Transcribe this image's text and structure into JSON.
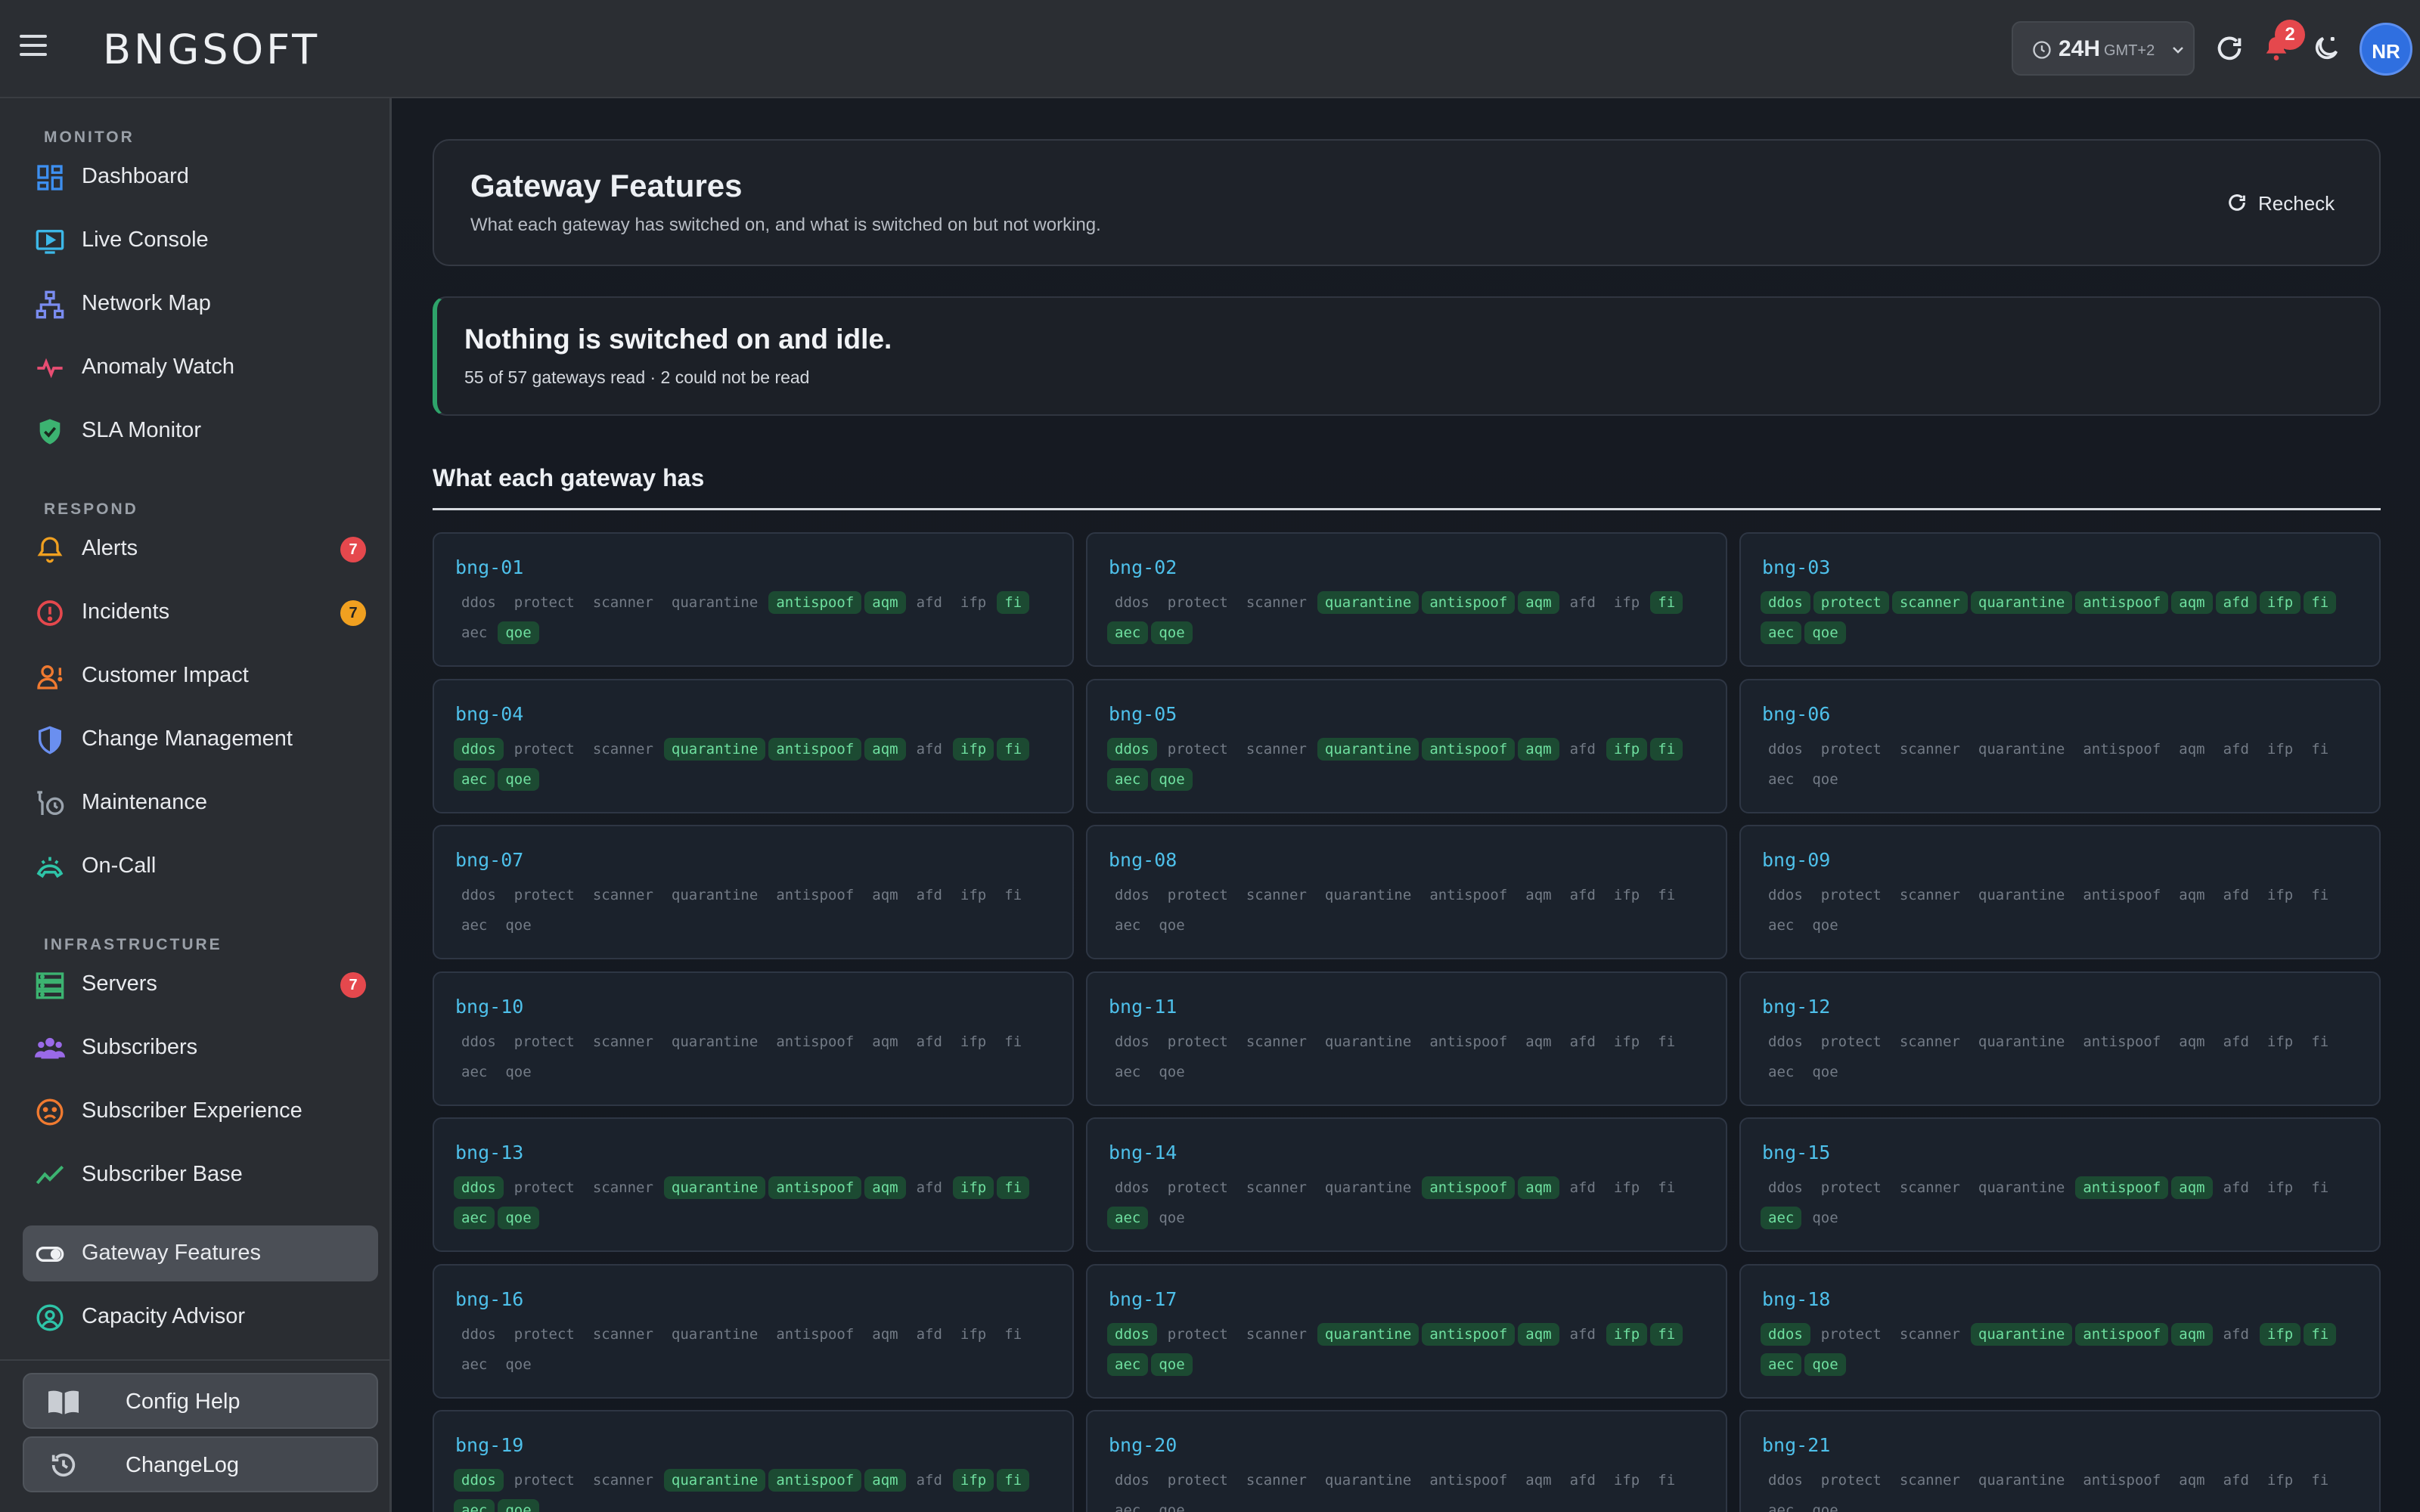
{
  "app": {
    "logo": "BNGSOFT",
    "time_range": "24H",
    "timezone": "GMT+2",
    "notification_count": "2",
    "user_initials": "NR"
  },
  "sidebar": {
    "sections": [
      {
        "label": "MONITOR"
      },
      {
        "label": "RESPOND"
      },
      {
        "label": "INFRASTRUCTURE"
      }
    ],
    "items": [
      {
        "label": "Dashboard",
        "icon": "dashboard-icon"
      },
      {
        "label": "Live Console",
        "icon": "monitor-play-icon"
      },
      {
        "label": "Network Map",
        "icon": "network-icon"
      },
      {
        "label": "Anomaly Watch",
        "icon": "pulse-icon"
      },
      {
        "label": "SLA Monitor",
        "icon": "shield-check-icon"
      },
      {
        "label": "Alerts",
        "icon": "bell-icon",
        "count": "7"
      },
      {
        "label": "Incidents",
        "icon": "alert-circle-icon",
        "count": "7"
      },
      {
        "label": "Customer Impact",
        "icon": "user-alert-icon"
      },
      {
        "label": "Change Management",
        "icon": "shield-half-icon"
      },
      {
        "label": "Maintenance",
        "icon": "wrench-clock-icon"
      },
      {
        "label": "On-Call",
        "icon": "headset-icon"
      },
      {
        "label": "Servers",
        "icon": "server-icon",
        "count": "7"
      },
      {
        "label": "Subscribers",
        "icon": "users-icon"
      },
      {
        "label": "Subscriber Experience",
        "icon": "sad-face-icon"
      },
      {
        "label": "Subscriber Base",
        "icon": "trend-line-icon"
      },
      {
        "label": "Gateway Features",
        "icon": "toggle-icon"
      },
      {
        "label": "Capacity Advisor",
        "icon": "gauge-icon"
      }
    ],
    "footer": {
      "config_help": "Config Help",
      "changelog": "ChangeLog"
    }
  },
  "header": {
    "title": "Gateway Features",
    "subtitle": "What each gateway has switched on, and what is switched on but not working.",
    "recheck_label": "Recheck"
  },
  "status": {
    "title": "Nothing is switched on and idle.",
    "detail": "55 of 57 gateways read · 2 could not be read"
  },
  "section_title": "What each gateway has",
  "features": [
    "ddos",
    "protect",
    "scanner",
    "quarantine",
    "antispoof",
    "aqm",
    "afd",
    "ifp",
    "fi",
    "aec",
    "qoe"
  ],
  "gateways": [
    {
      "name": "bng-01",
      "on": [
        "antispoof",
        "aqm",
        "fi",
        "qoe"
      ]
    },
    {
      "name": "bng-02",
      "on": [
        "quarantine",
        "antispoof",
        "aqm",
        "fi",
        "aec",
        "qoe"
      ]
    },
    {
      "name": "bng-03",
      "on": [
        "ddos",
        "protect",
        "scanner",
        "quarantine",
        "antispoof",
        "aqm",
        "afd",
        "ifp",
        "fi",
        "aec",
        "qoe"
      ]
    },
    {
      "name": "bng-04",
      "on": [
        "ddos",
        "quarantine",
        "antispoof",
        "aqm",
        "ifp",
        "fi",
        "aec",
        "qoe"
      ]
    },
    {
      "name": "bng-05",
      "on": [
        "ddos",
        "quarantine",
        "antispoof",
        "aqm",
        "ifp",
        "fi",
        "aec",
        "qoe"
      ]
    },
    {
      "name": "bng-06",
      "on": []
    },
    {
      "name": "bng-07",
      "on": []
    },
    {
      "name": "bng-08",
      "on": []
    },
    {
      "name": "bng-09",
      "on": []
    },
    {
      "name": "bng-10",
      "on": []
    },
    {
      "name": "bng-11",
      "on": []
    },
    {
      "name": "bng-12",
      "on": []
    },
    {
      "name": "bng-13",
      "on": [
        "ddos",
        "quarantine",
        "antispoof",
        "aqm",
        "ifp",
        "fi",
        "aec",
        "qoe"
      ]
    },
    {
      "name": "bng-14",
      "on": [
        "antispoof",
        "aqm",
        "aec"
      ]
    },
    {
      "name": "bng-15",
      "on": [
        "antispoof",
        "aqm",
        "aec"
      ]
    },
    {
      "name": "bng-16",
      "on": []
    },
    {
      "name": "bng-17",
      "on": [
        "ddos",
        "quarantine",
        "antispoof",
        "aqm",
        "ifp",
        "fi",
        "aec",
        "qoe"
      ]
    },
    {
      "name": "bng-18",
      "on": [
        "ddos",
        "quarantine",
        "antispoof",
        "aqm",
        "ifp",
        "fi",
        "aec",
        "qoe"
      ]
    },
    {
      "name": "bng-19",
      "on": [
        "ddos",
        "quarantine",
        "antispoof",
        "aqm",
        "ifp",
        "fi",
        "aec",
        "qoe"
      ]
    },
    {
      "name": "bng-20",
      "on": []
    },
    {
      "name": "bng-21",
      "on": []
    }
  ],
  "colors": {
    "accent_blue": "#4ec0ea",
    "feature_on_bg": "#1c4a32",
    "feature_on_text": "#6fe0a0",
    "status_ok": "#2ea36a",
    "badge_red": "#e5484d",
    "badge_amber": "#f0a020"
  }
}
